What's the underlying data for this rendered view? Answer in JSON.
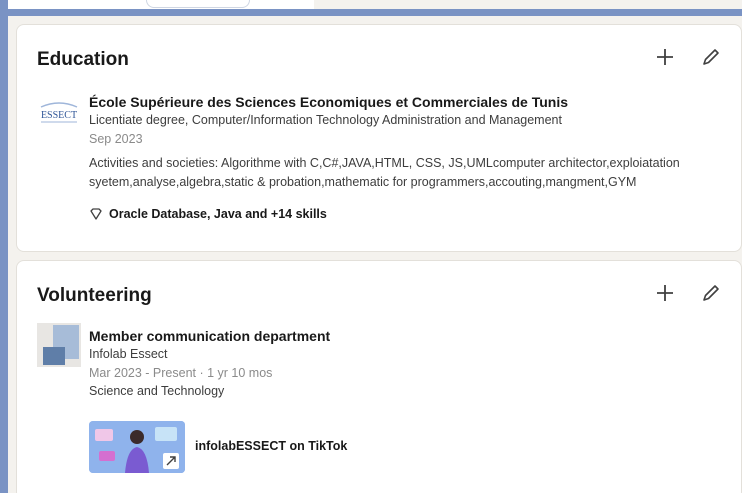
{
  "education": {
    "section_title": "Education",
    "add_icon": "plus-icon",
    "edit_icon": "pencil-icon",
    "entry": {
      "logo_text": "ESSECT",
      "school": "École Supérieure des Sciences Economiques et Commerciales de Tunis",
      "degree": "Licentiate degree, Computer/Information Technology Administration and Management",
      "date": "Sep 2023",
      "activities": "Activities and societies: Algorithme with C,C#,JAVA,HTML, CSS, JS,UMLcomputer architector,exploiatation syetem,analyse,algebra,static & probation,mathematic for programmers,accouting,mangment,GYM",
      "skills": "Oracle Database, Java and +14 skills"
    }
  },
  "volunteering": {
    "section_title": "Volunteering",
    "add_icon": "plus-icon",
    "edit_icon": "pencil-icon",
    "entry": {
      "role": "Member communication department",
      "organization": "Infolab Essect",
      "dates": "Mar 2023 - Present · 1 yr 10 mos",
      "cause": "Science and Technology",
      "media_title": "infolabESSECT on TikTok"
    }
  },
  "colors": {
    "frame": "#7a93c4",
    "page_bg": "#f4f2ee",
    "card_bg": "#ffffff"
  }
}
